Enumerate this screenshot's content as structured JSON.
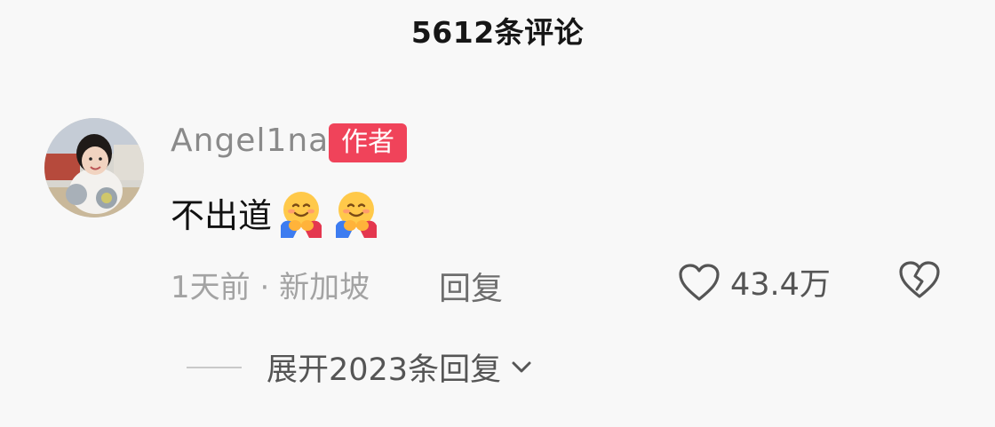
{
  "header": {
    "title": "5612条评论"
  },
  "comment": {
    "username": "Angel1na",
    "author_badge": "作者",
    "text": "不出道",
    "emojis": [
      "hugging-face-icon",
      "hugging-face-icon"
    ],
    "time": "1天前",
    "separator": " · ",
    "location": "新加坡",
    "reply_label": "回复",
    "like_count": "43.4万",
    "expand_label": "展开2023条回复"
  },
  "colors": {
    "badge": "#f0435a",
    "username": "#8a8a8a",
    "meta": "#a3a3a3"
  }
}
